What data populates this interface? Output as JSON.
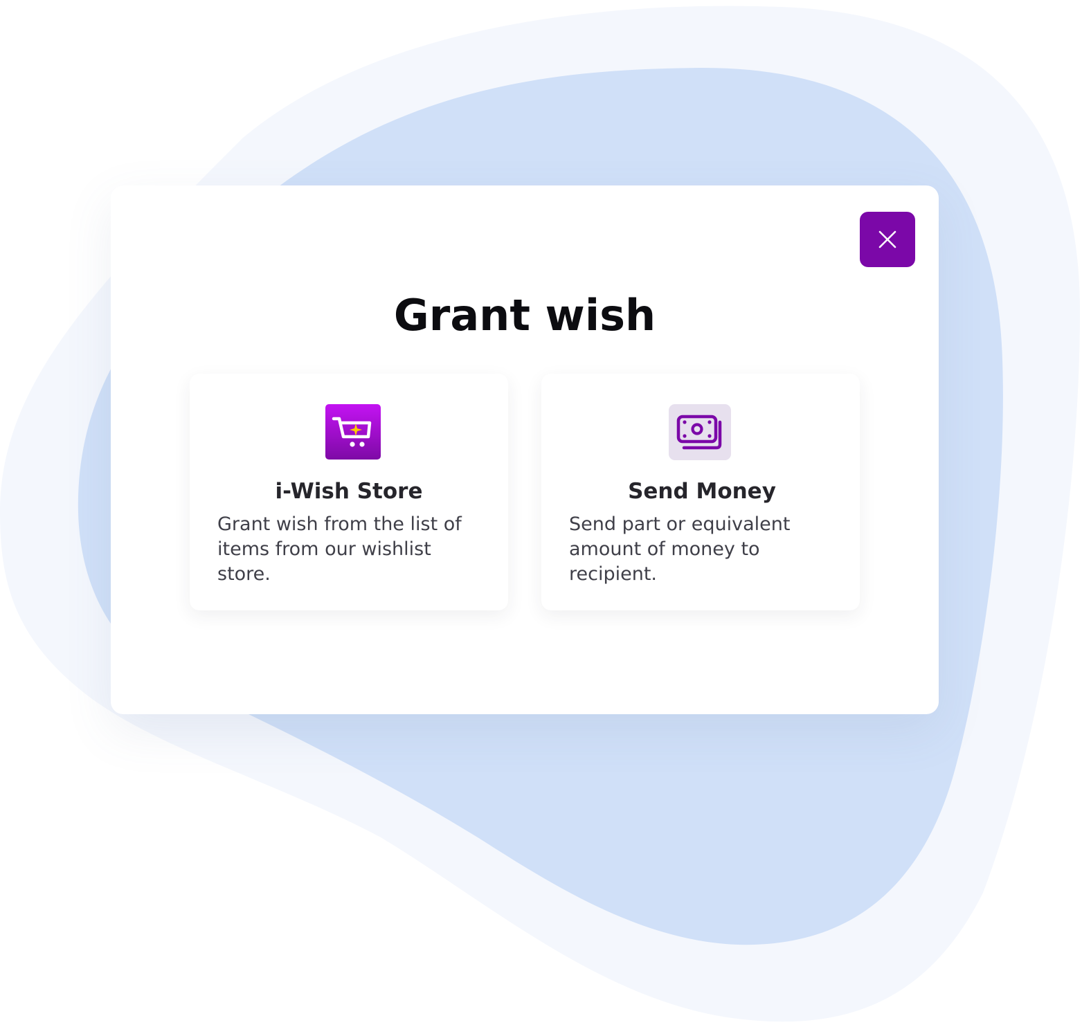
{
  "modal": {
    "title": "Grant wish",
    "close_icon": "close-icon",
    "accent_color": "#7b08a8"
  },
  "options": [
    {
      "title": "i-Wish Store",
      "description": "Grant wish from the list of items from our wishlist store.",
      "icon": "shopping-cart-sparkle-icon"
    },
    {
      "title": "Send Money",
      "description": "Send part or equivalent amount of money to recipient.",
      "icon": "money-bills-icon"
    }
  ],
  "background": {
    "outer_blob_color": "#f4f7fd",
    "inner_blob_color": "#d0e0f8"
  }
}
